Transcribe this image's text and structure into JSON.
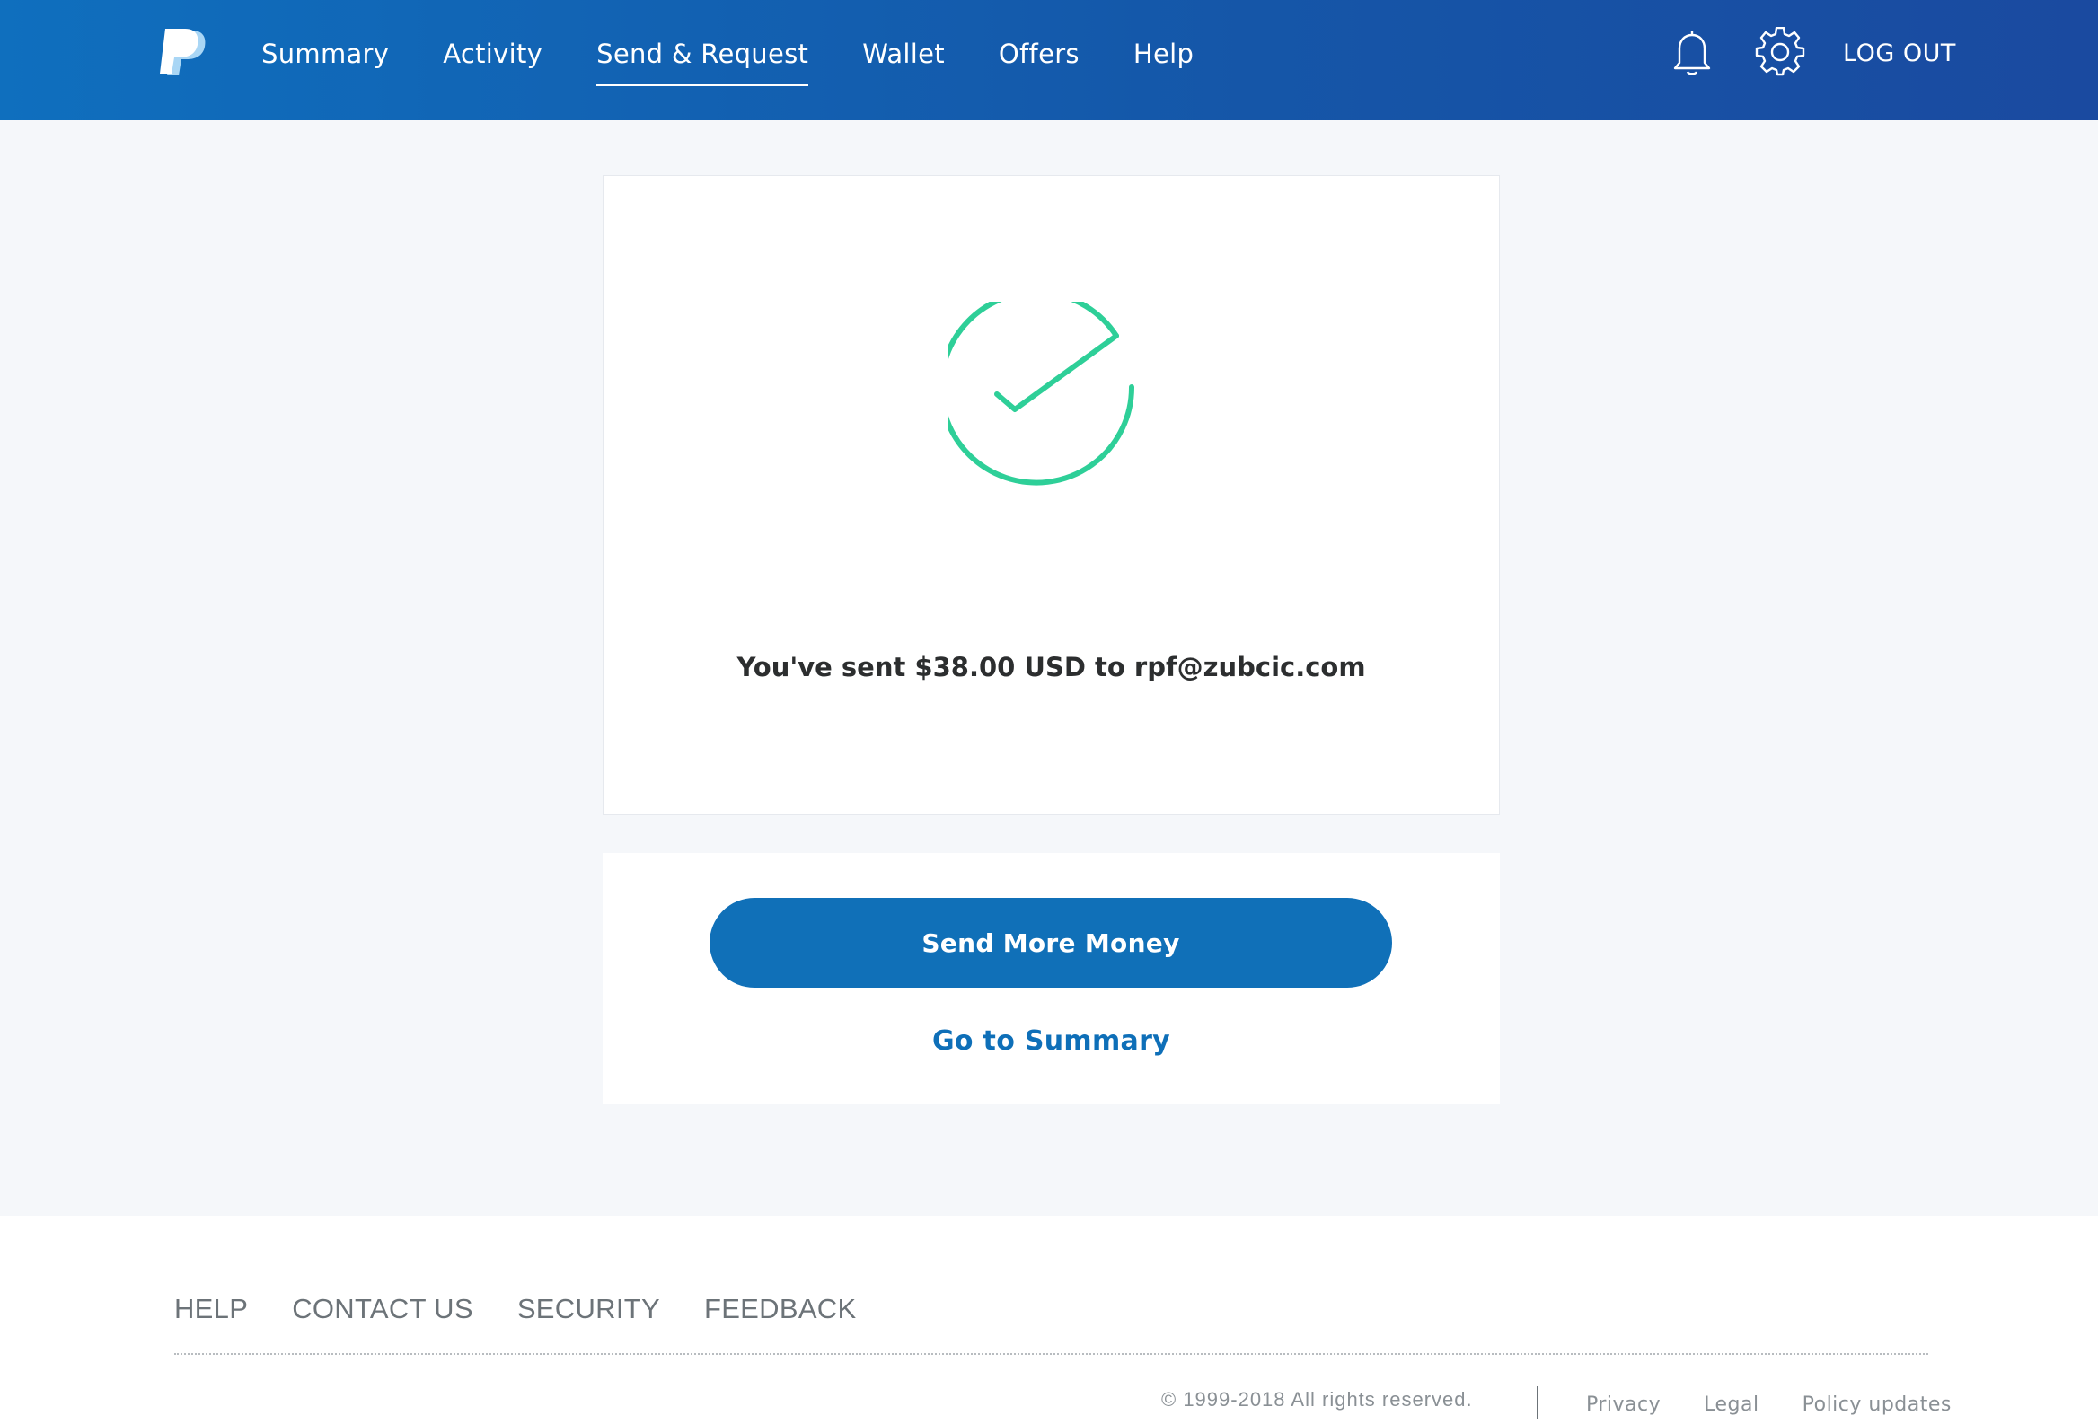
{
  "header": {
    "logo_icon": "paypal-logo-icon",
    "nav": [
      {
        "label": "Summary",
        "active": false
      },
      {
        "label": "Activity",
        "active": false
      },
      {
        "label": "Send & Request",
        "active": true
      },
      {
        "label": "Wallet",
        "active": false
      },
      {
        "label": "Offers",
        "active": false
      },
      {
        "label": "Help",
        "active": false
      }
    ],
    "notifications_icon": "bell-icon",
    "settings_icon": "gear-icon",
    "logout_label": "LOG OUT"
  },
  "confirmation": {
    "status_icon": "check-circle-icon",
    "message": "You've sent $38.00 USD to rpf@zubcic.com"
  },
  "actions": {
    "primary_label": "Send More Money",
    "secondary_label": "Go to Summary"
  },
  "footer": {
    "links": [
      "HELP",
      "CONTACT US",
      "SECURITY",
      "FEEDBACK"
    ],
    "copyright": "© 1999-2018 All rights reserved.",
    "legal_links": [
      "Privacy",
      "Legal",
      "Policy updates"
    ]
  },
  "colors": {
    "header_start": "#0f6fbe",
    "header_end": "#1a4aa0",
    "success_green": "#2ecf98",
    "primary_button": "#1070b8",
    "link_blue": "#0e6fb8"
  }
}
